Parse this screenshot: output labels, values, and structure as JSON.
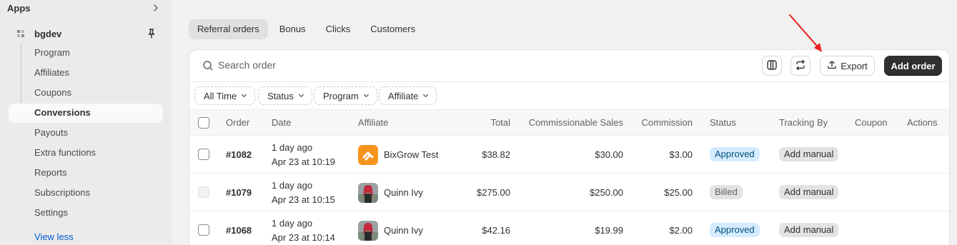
{
  "sidebar": {
    "apps_label": "Apps",
    "app_name": "bgdev",
    "items": [
      {
        "label": "Program"
      },
      {
        "label": "Affiliates"
      },
      {
        "label": "Coupons"
      },
      {
        "label": "Conversions"
      },
      {
        "label": "Payouts"
      },
      {
        "label": "Extra functions"
      },
      {
        "label": "Reports"
      },
      {
        "label": "Subscriptions"
      },
      {
        "label": "Settings"
      }
    ],
    "view_less": "View less",
    "active_index": 3
  },
  "tabs": [
    {
      "label": "Referral orders",
      "active": true
    },
    {
      "label": "Bonus"
    },
    {
      "label": "Clicks"
    },
    {
      "label": "Customers"
    }
  ],
  "toolbar": {
    "search_placeholder": "Search order",
    "export_label": "Export",
    "add_order_label": "Add order"
  },
  "filters": [
    {
      "label": "All Time"
    },
    {
      "label": "Status"
    },
    {
      "label": "Program"
    },
    {
      "label": "Affiliate"
    }
  ],
  "table": {
    "columns": {
      "order": "Order",
      "date": "Date",
      "affiliate": "Affiliate",
      "total": "Total",
      "commissionable": "Commissionable Sales",
      "commission": "Commission",
      "status": "Status",
      "tracking": "Tracking By",
      "coupon": "Coupon",
      "actions": "Actions"
    },
    "rows": [
      {
        "order": "#1082",
        "date_relative": "1 day ago",
        "date": "Apr 23 at 10:19",
        "affiliate": "BixGrow Test",
        "total": "$38.82",
        "commissionable": "$30.00",
        "commission": "$3.00",
        "status": "Approved",
        "tracking": "Add manual",
        "coupon": "",
        "checkbox_disabled": false,
        "avatar": "bixgrow-logo"
      },
      {
        "order": "#1079",
        "date_relative": "1 day ago",
        "date": "Apr 23 at 10:15",
        "affiliate": "Quinn Ivy",
        "total": "$275.00",
        "commissionable": "$250.00",
        "commission": "$25.00",
        "status": "Billed",
        "tracking": "Add manual",
        "coupon": "",
        "checkbox_disabled": true,
        "avatar": "person-photo"
      },
      {
        "order": "#1068",
        "date_relative": "1 day ago",
        "date": "Apr 23 at 10:14",
        "affiliate": "Quinn Ivy",
        "total": "$42.16",
        "commissionable": "$19.99",
        "commission": "$2.00",
        "status": "Approved",
        "tracking": "Add manual",
        "coupon": "",
        "checkbox_disabled": false,
        "avatar": "person-photo"
      }
    ]
  },
  "colors": {
    "approved_bg": "#d5ebff",
    "approved_text": "#00527c",
    "annotation_arrow": "#e8201c",
    "primary_button": "#303030",
    "link": "#005bd3"
  },
  "icons": [
    "chevron-right-icon",
    "app-grid-icon",
    "pin-icon",
    "search-icon",
    "columns-icon",
    "sync-icon",
    "upload-icon",
    "chevron-down-icon",
    "annotation-arrow"
  ]
}
